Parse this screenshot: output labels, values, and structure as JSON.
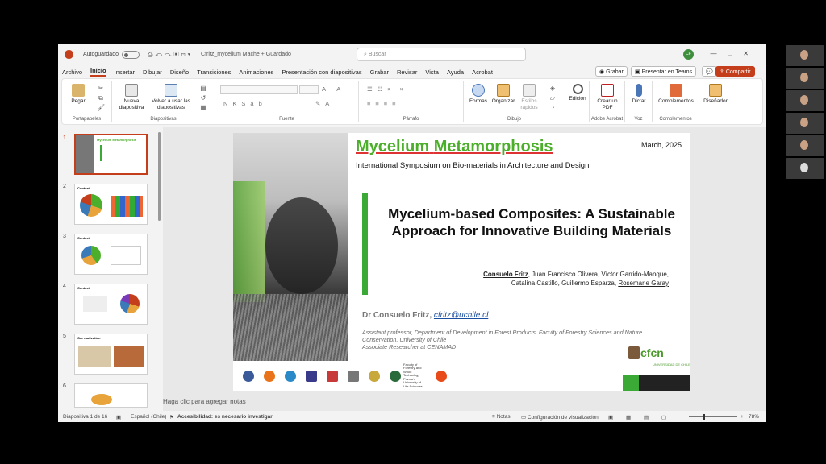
{
  "titlebar": {
    "autosave_label": "Autoguardado",
    "autosave_state": "off",
    "filename": "Cfritz_mycelium Mache + Guardado",
    "search_placeholder": "Buscar",
    "user_initials": "CF"
  },
  "tabs": [
    "Archivo",
    "Inicio",
    "Insertar",
    "Dibujar",
    "Diseño",
    "Transiciones",
    "Animaciones",
    "Presentación con diapositivas",
    "Grabar",
    "Revisar",
    "Vista",
    "Ayuda",
    "Acrobat"
  ],
  "tab_actions": {
    "record": "Grabar",
    "present_teams": "Presentar en Teams",
    "share": "Compartir"
  },
  "ribbon": {
    "paste": "Pegar",
    "new_slide": "Nueva diapositiva",
    "reuse_slides": "Volver a usar las diapositivas",
    "shapes": "Formas",
    "arrange": "Organizar",
    "quick_styles": "Estilos rápidos",
    "edit": "Edición",
    "create_pdf": "Crear un PDF",
    "dictate": "Dictar",
    "addins": "Complementos",
    "designer": "Diseñador",
    "groups": {
      "clipboard": "Portapapeles",
      "slides": "Diapositivas",
      "font": "Fuente",
      "paragraph": "Párrafo",
      "drawing": "Dibujo",
      "adobe": "Adobe Acrobat",
      "voice": "Voz",
      "addins": "Complementos"
    }
  },
  "thumbnails": [
    {
      "num": "1",
      "title": "Mycelium Metamorphosis"
    },
    {
      "num": "2",
      "title": "Context"
    },
    {
      "num": "3",
      "title": "Context"
    },
    {
      "num": "4",
      "title": "Context"
    },
    {
      "num": "5",
      "title": "Our motivation"
    },
    {
      "num": "6",
      "title": ""
    }
  ],
  "slide": {
    "title_word1": "Mycelium",
    "title_word2": "Metamorphosis",
    "date": "March, 2025",
    "symposium": "International Symposium on Bio-materials in Architecture and Design",
    "main_title": "Mycelium-based Composites: A Sustainable Approach for Innovative Building Materials",
    "authors_lead": "Consuelo Fritz",
    "authors_rest1": ", Juan Francisco Olivera, Víctor Garrido-Manque,",
    "authors_line2a": "Catalina Castillo, Guillermo Esparza, ",
    "authors_last": "Rosemarie Garay",
    "presenter": "Dr Consuelo Fritz, ",
    "email": "cfritz@uchile.cl",
    "affiliation": "Assistant professor, Department of Development in Forest Products, Faculty of Forestry Sciences and Nature Conservation, University of Chile\nAssociate Researcher at CENAMAD",
    "cfcn": "cfcn",
    "cfcn_sub": "UNIVERSIDAD DE CHILE",
    "logo_labels": [
      "Faculty of Forestry and Wood Technology",
      "Poznań University of Life Sciences"
    ]
  },
  "notes_placeholder": "Haga clic para agregar notas",
  "status": {
    "slide_indicator": "Diapositiva 1 de 16",
    "language": "Español (Chile)",
    "accessibility": "Accesibilidad: es necesario investigar",
    "notes": "Notas",
    "view_settings": "Configuración de visualización",
    "zoom": "78%"
  },
  "colors": {
    "accent": "#c43e1c",
    "title_green": "#4caf2b",
    "bar_green": "#3aa935"
  }
}
